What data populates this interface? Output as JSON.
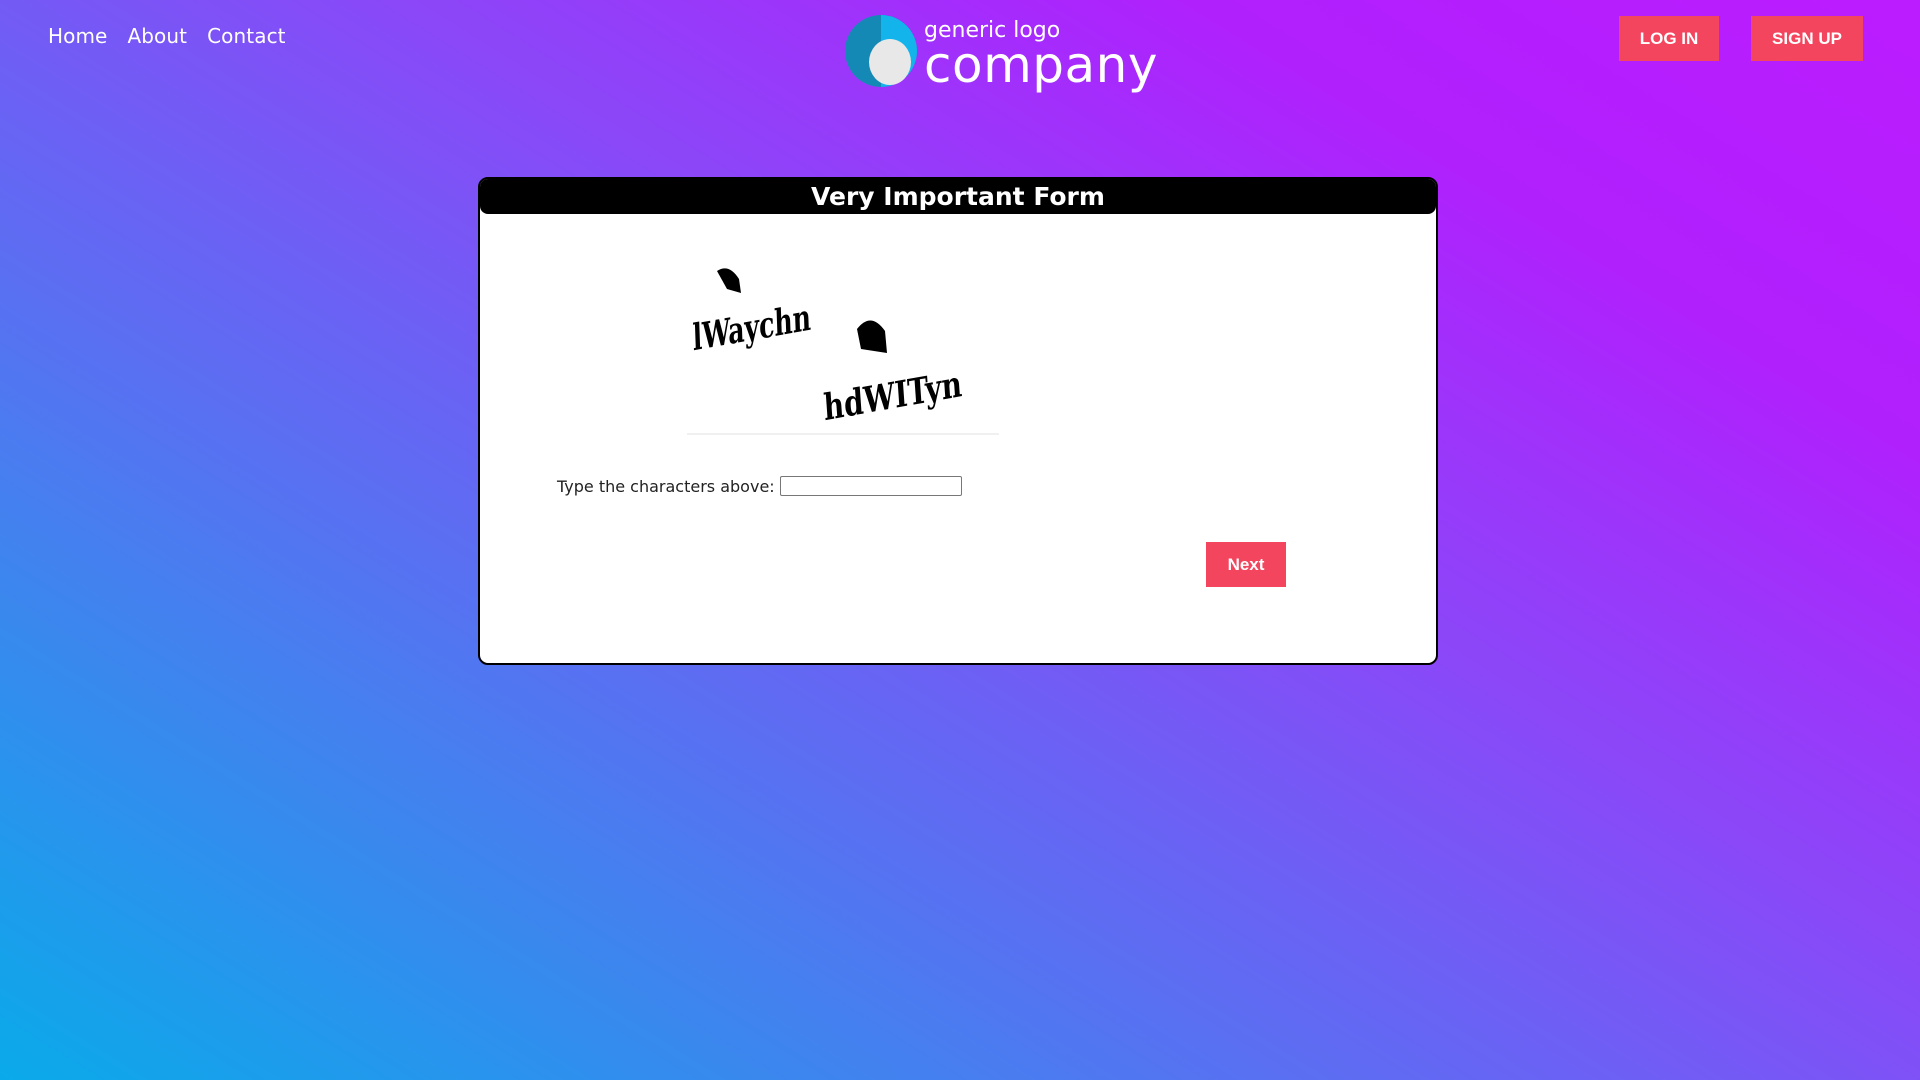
{
  "nav": {
    "items": [
      {
        "label": "Home"
      },
      {
        "label": "About"
      },
      {
        "label": "Contact"
      }
    ]
  },
  "logo": {
    "line1": "generic logo",
    "line2": "company",
    "icon": "circle-logo-icon",
    "colors": {
      "dark": "#1589b5",
      "light": "#13b3ec",
      "inner": "#e8e8e8"
    }
  },
  "auth": {
    "login_label": "LOG IN",
    "signup_label": "SIGN UP"
  },
  "form": {
    "title": "Very Important Form",
    "captcha_words": [
      "lWaychn",
      "hdWITyn"
    ],
    "captcha_prompt": "Type the characters above:",
    "captcha_value": "",
    "next_label": "Next"
  },
  "colors": {
    "accent": "#f4455e",
    "gradient_start": "#0aaaea",
    "gradient_end": "#bb1cff",
    "card_header": "#000000"
  }
}
